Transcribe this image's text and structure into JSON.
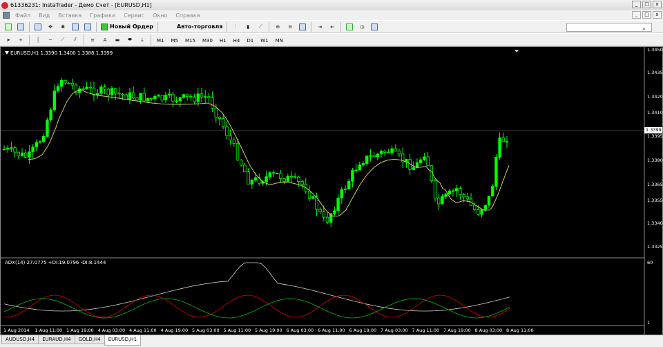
{
  "window": {
    "title": "61336231: InstaTrader - Демо Счет - [EURUSD,H1]",
    "min": "_",
    "max": "□",
    "close": "x"
  },
  "menu": [
    "Файл",
    "Вид",
    "Вставка",
    "Графики",
    "Сервис",
    "Окно",
    "Справка"
  ],
  "toolbar": {
    "new_order": "Новый Ордер",
    "auto_trading": "Авто-торговля",
    "search_placeholder": ""
  },
  "periods": [
    "M1",
    "M5",
    "M15",
    "M30",
    "H1",
    "H4",
    "D1",
    "W1",
    "MN"
  ],
  "chart": {
    "info": "EURUSD,H1  1.3390 1.3400 1.3388 1.3399",
    "current_price": "1.3399",
    "price_labels": [
      "1.3450",
      "1.3435",
      "1.3420",
      "1.3410",
      "1.3395",
      "1.3380",
      "1.3365",
      "1.3355",
      "1.3340",
      "1.3325"
    ],
    "indicator_info": "ADX(14) 27.0775 +DI:19.0796 -DI:8.1444",
    "indicator_labels": [
      "60",
      "1"
    ],
    "time_labels": [
      "1 Aug 2014",
      "1 Aug 11:00",
      "1 Aug 19:00",
      "4 Aug 03:00",
      "4 Aug 11:00",
      "4 Aug 19:00",
      "5 Aug 03:00",
      "5 Aug 11:00",
      "5 Aug 19:00",
      "6 Aug 03:00",
      "6 Aug 11:00",
      "6 Aug 19:00",
      "7 Aug 03:00",
      "7 Aug 11:00",
      "7 Aug 19:00",
      "8 Aug 03:00",
      "8 Aug 11:00"
    ],
    "colors": {
      "bull": "#00ff00",
      "bear": "#00ff00",
      "ma": "#cccc66",
      "adx": "#d0d0d0",
      "plus_di": "#00c000",
      "minus_di": "#e00000"
    }
  },
  "tabs": [
    "AUDUSD,H4",
    "EURAUD,H4",
    "GOLD,H4",
    "EURUSD,H1"
  ],
  "active_tab": 3
}
